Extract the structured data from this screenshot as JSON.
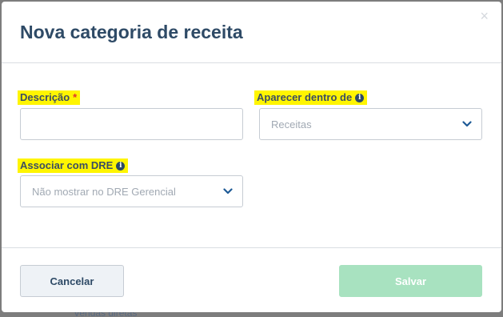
{
  "backdrop": {
    "text": "Vendas diretas"
  },
  "modal": {
    "title": "Nova categoria de receita",
    "close_icon": "×"
  },
  "form": {
    "descricao": {
      "label": "Descrição",
      "required_mark": "*",
      "value": ""
    },
    "aparecer": {
      "label": "Aparecer dentro de",
      "info_icon": "i",
      "value": "Receitas"
    },
    "associar": {
      "label": "Associar com DRE",
      "info_icon": "i",
      "value": "Não mostrar no DRE Gerencial"
    }
  },
  "footer": {
    "cancel_label": "Cancelar",
    "save_label": "Salvar"
  },
  "colors": {
    "title": "#2e4a66",
    "highlight": "#fff500",
    "save_disabled": "#a8e2c0",
    "chevron": "#1e5a96"
  }
}
